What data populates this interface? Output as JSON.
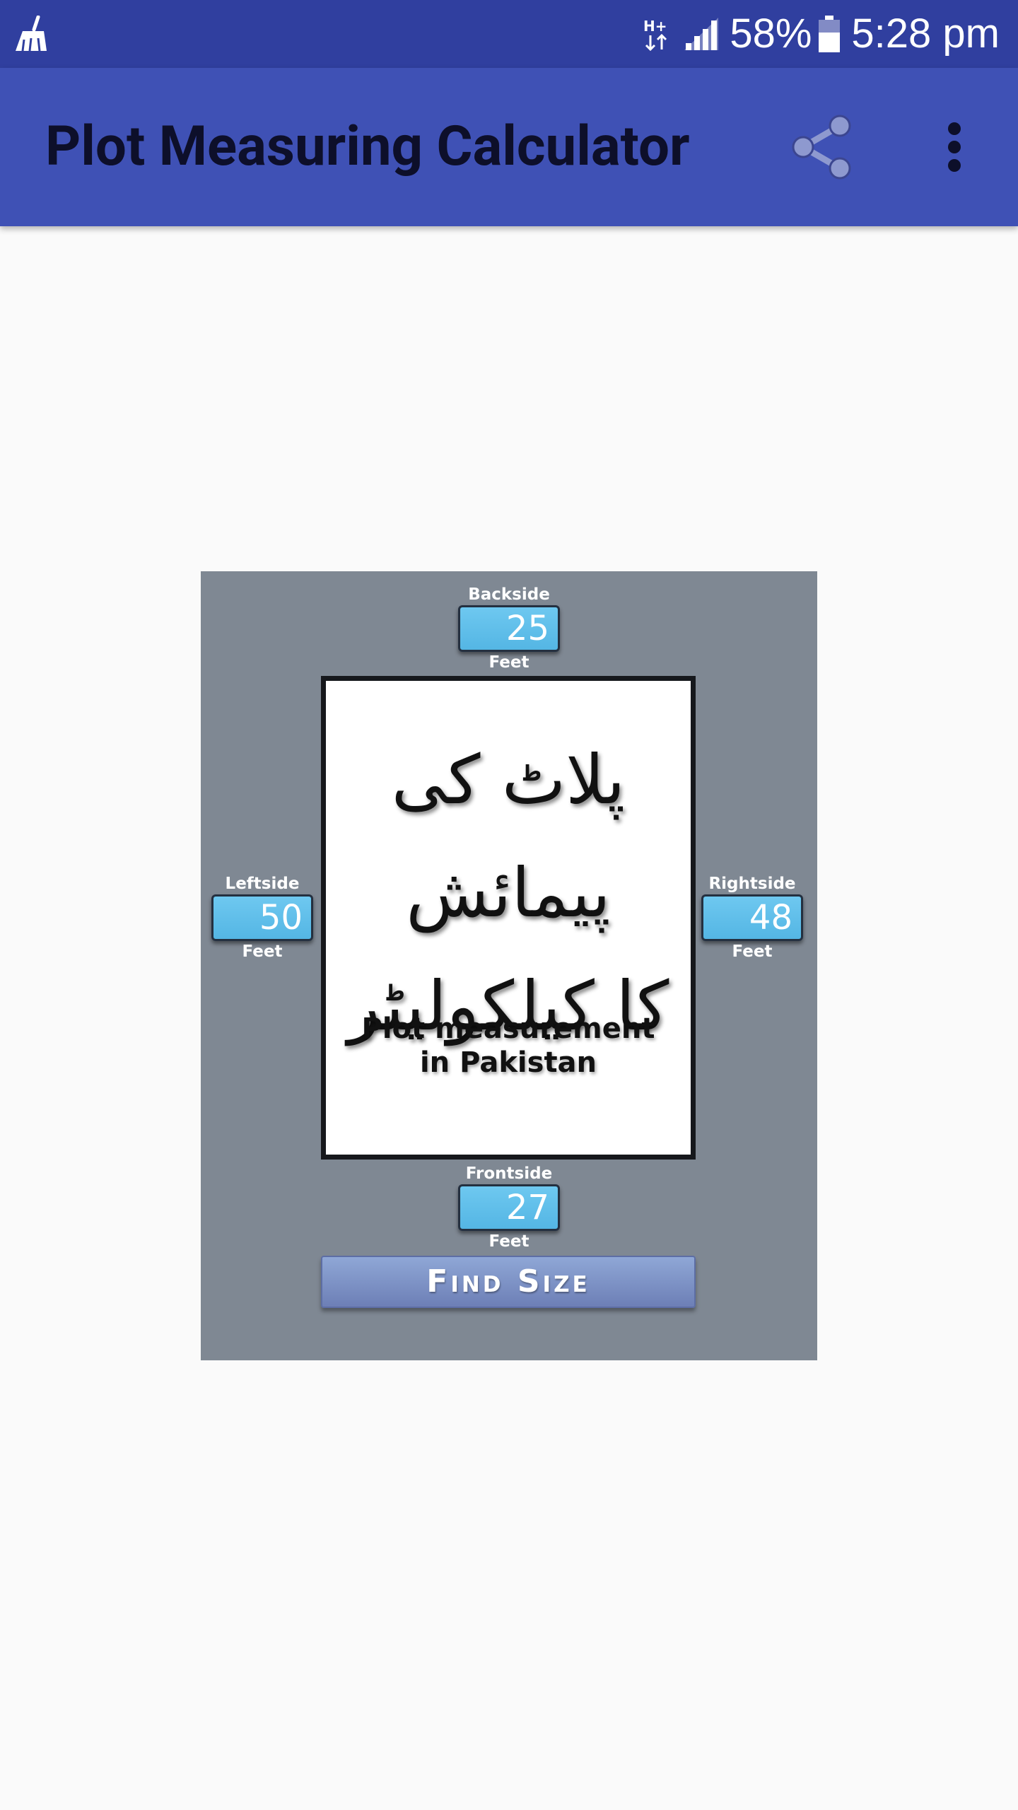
{
  "status_bar": {
    "cleaner_icon": "broom-icon",
    "network_type": "H+",
    "battery_percent": "58%",
    "time": "5:28 pm"
  },
  "app_bar": {
    "title": "Plot Measuring Calculator",
    "share_icon": "share-icon",
    "more_icon": "more-vert-icon"
  },
  "hero": {
    "backside": {
      "label": "Backside",
      "value": "25",
      "unit": "Feet"
    },
    "leftside": {
      "label": "Leftside",
      "value": "50",
      "unit": "Feet"
    },
    "rightside": {
      "label": "Rightside",
      "value": "48",
      "unit": "Feet"
    },
    "frontside": {
      "label": "Frontside",
      "value": "27",
      "unit": "Feet"
    },
    "urdu_title_line1": "پلاٹ کی پیمائش",
    "urdu_title_line2": "کا کیلکولیٹر",
    "english_title_line1": "Plot measurement",
    "english_title_line2": "in Pakistan",
    "button_label": "Find Size"
  },
  "colors": {
    "status_bar": "#303f9f",
    "app_bar": "#3f51b5",
    "background": "#fafafa",
    "hero_background": "#7f8893",
    "field_box": "#5fbfea"
  }
}
